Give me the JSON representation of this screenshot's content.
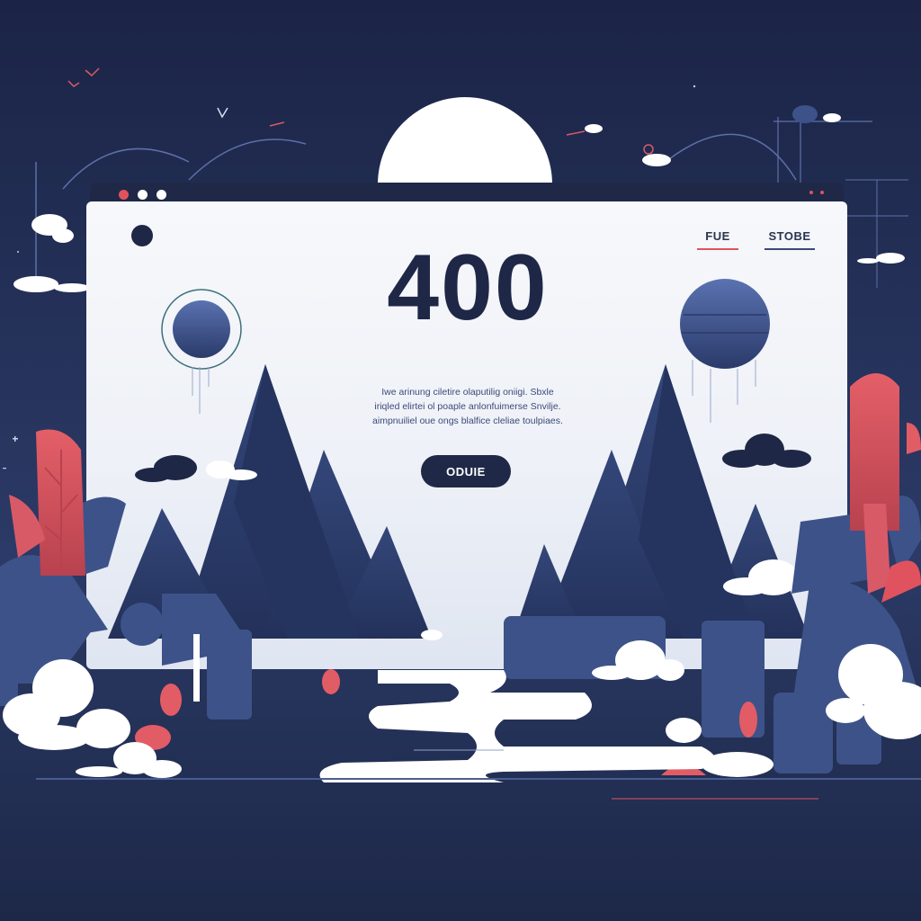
{
  "page": {
    "error_code": "400",
    "message_lines": [
      "Iwe arinung ciletire olaputilig oniigi. Sbxle",
      "iriqled elirtei ol poaple anlonfuimerse Snvilje.",
      "aimpnuiliel oue ongs blalfice cleliae toulpiaes."
    ],
    "button_label": "ODUIE"
  },
  "nav": {
    "links": [
      {
        "label": "FUE",
        "accent": "#e0525e"
      },
      {
        "label": "STOBE",
        "accent": "#3b4a7a"
      }
    ]
  },
  "colors": {
    "background": "#1e2a4a",
    "window": "#f4f6fa",
    "accent": "#e25c66",
    "mountain": "#2e3f6c",
    "foliage": "#3d5288",
    "cloud": "#ffffff",
    "dot_red": "#e0525e",
    "dot_white": "#ffffff"
  },
  "icons": {
    "window_dots": [
      "red-dot-icon",
      "white-dot-icon",
      "white-dot-icon"
    ],
    "camera": "circle-icon",
    "planet_left": "planet-icon",
    "planet_right": "planet-icon"
  }
}
